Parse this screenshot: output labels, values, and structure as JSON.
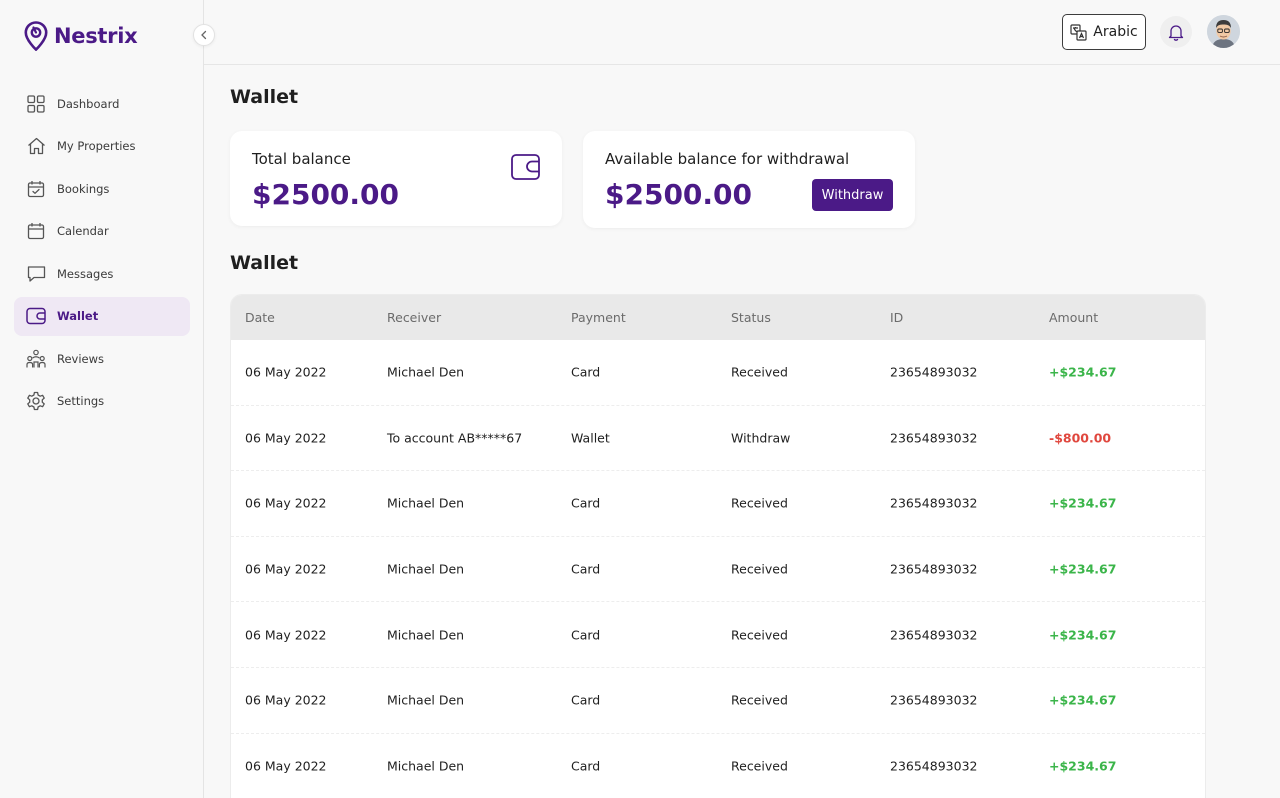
{
  "brand": {
    "name": "Nestrix",
    "color": "#4b1a87"
  },
  "sidebar": {
    "items": [
      {
        "label": "Dashboard",
        "icon": "grid-icon",
        "active": false
      },
      {
        "label": "My Properties",
        "icon": "home-icon",
        "active": false
      },
      {
        "label": "Bookings",
        "icon": "calendar-check-icon",
        "active": false
      },
      {
        "label": "Calendar",
        "icon": "calendar-icon",
        "active": false
      },
      {
        "label": "Messages",
        "icon": "message-icon",
        "active": false
      },
      {
        "label": "Wallet",
        "icon": "wallet-icon",
        "active": true
      },
      {
        "label": "Reviews",
        "icon": "reviews-icon",
        "active": false
      },
      {
        "label": "Settings",
        "icon": "gear-icon",
        "active": false
      }
    ]
  },
  "header": {
    "language_label": "Arabic"
  },
  "page": {
    "title": "Wallet",
    "section_title": "Wallet"
  },
  "cards": {
    "total": {
      "label": "Total balance",
      "amount": "$2500.00"
    },
    "available": {
      "label": "Available balance for withdrawal",
      "amount": "$2500.00",
      "button": "Withdraw"
    }
  },
  "table": {
    "columns": [
      "Date",
      "Receiver",
      "Payment",
      "Status",
      "ID",
      "Amount"
    ],
    "rows": [
      {
        "date": "06 May 2022",
        "receiver": "Michael Den",
        "payment": "Card",
        "status": "Received",
        "id": "23654893032",
        "amount": "+$234.67",
        "positive": true
      },
      {
        "date": "06 May 2022",
        "receiver": "To account AB*****67",
        "payment": "Wallet",
        "status": "Withdraw",
        "id": "23654893032",
        "amount": "-$800.00",
        "positive": false
      },
      {
        "date": "06 May 2022",
        "receiver": "Michael Den",
        "payment": "Card",
        "status": "Received",
        "id": "23654893032",
        "amount": "+$234.67",
        "positive": true
      },
      {
        "date": "06 May 2022",
        "receiver": "Michael Den",
        "payment": "Card",
        "status": "Received",
        "id": "23654893032",
        "amount": "+$234.67",
        "positive": true
      },
      {
        "date": "06 May 2022",
        "receiver": "Michael Den",
        "payment": "Card",
        "status": "Received",
        "id": "23654893032",
        "amount": "+$234.67",
        "positive": true
      },
      {
        "date": "06 May 2022",
        "receiver": "Michael Den",
        "payment": "Card",
        "status": "Received",
        "id": "23654893032",
        "amount": "+$234.67",
        "positive": true
      },
      {
        "date": "06 May 2022",
        "receiver": "Michael Den",
        "payment": "Card",
        "status": "Received",
        "id": "23654893032",
        "amount": "+$234.67",
        "positive": true
      }
    ]
  },
  "colors": {
    "positive": "#3bb54a",
    "negative": "#e0473e",
    "accent": "#4b1a87"
  }
}
